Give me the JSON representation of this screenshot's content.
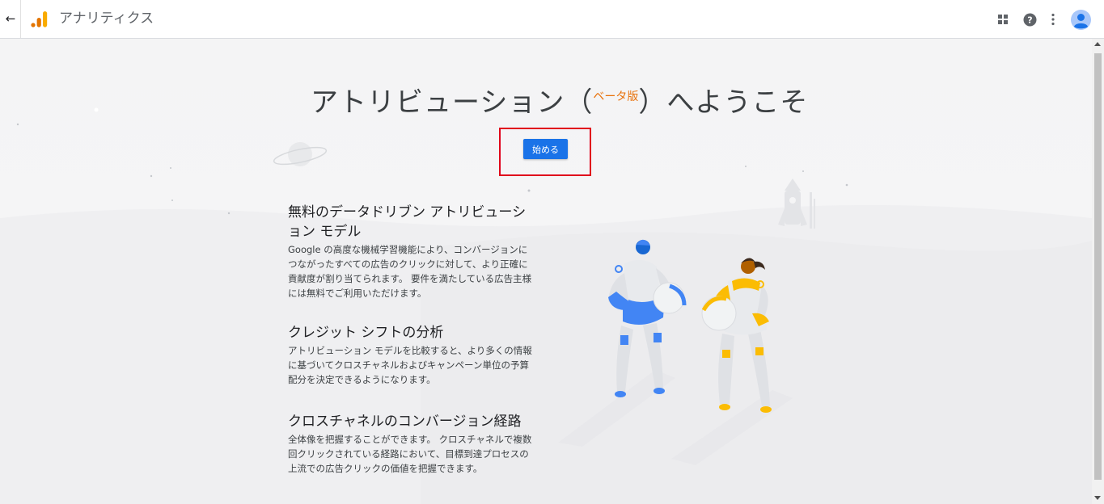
{
  "topbar": {
    "back_icon": "back-arrow-icon",
    "app_title": "アナリティクス",
    "icons": [
      "apps-grid-icon",
      "help-icon",
      "more-vert-icon",
      "account-avatar-icon"
    ],
    "brand_colors": {
      "analytics_orange": "#f9ab00",
      "analytics_dark": "#e37400"
    }
  },
  "welcome": {
    "title_before": "アトリビューション（",
    "beta_label": "ベータ版",
    "title_after": "）へようこそ",
    "start_button": "始める",
    "accent_color": "#1a73e8",
    "highlight_color": "#e0001b"
  },
  "features": [
    {
      "heading": "無料のデータドリブン アトリビューション モデル",
      "body": "Google の高度な機械学習機能により、コンバージョンにつながったすべての広告のクリックに対して、より正確に貢献度が割り当てられます。 要件を満たしている広告主様には無料でご利用いただけます。"
    },
    {
      "heading": "クレジット シフトの分析",
      "body": "アトリビューション モデルを比較すると、より多くの情報に基づいてクロスチャネルおよびキャンペーン単位の予算配分を決定できるようになります。"
    },
    {
      "heading": "クロスチャネルのコンバージョン経路",
      "body": "全体像を把握することができます。 クロスチャネルで複数回クリックされている経路において、目標到達プロセスの上流での広告クリックの価値を把握できます。"
    }
  ],
  "illustration": {
    "subject": "two astronauts with a rocket and planet",
    "colors": {
      "blue_suit": "#4285f4",
      "yellow_suit": "#fbbc04"
    }
  }
}
